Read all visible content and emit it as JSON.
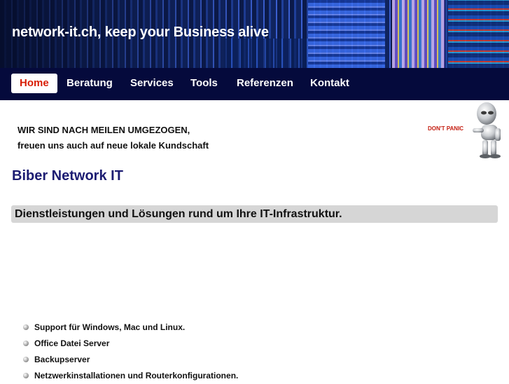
{
  "header": {
    "site_title": "network-it.ch, keep your Business alive"
  },
  "nav": {
    "items": [
      {
        "label": "Home",
        "active": true
      },
      {
        "label": "Beratung"
      },
      {
        "label": "Services"
      },
      {
        "label": "Tools"
      },
      {
        "label": "Referenzen"
      },
      {
        "label": "Kontakt"
      }
    ]
  },
  "notice": {
    "line1": "WIR SIND NACH MEILEN UMGEZOGEN,",
    "line2": "freuen uns auch auf neue lokale Kundschaft"
  },
  "robot_image": {
    "sign_text": "DON'T PANIC"
  },
  "main": {
    "title": "Biber Network IT",
    "tagline": "Dienstleistungen und Lösungen rund um Ihre IT-Infrastruktur.",
    "services": [
      "Support für Windows, Mac und Linux.",
      "Office Datei Server",
      "Backupserver",
      "Netzwerkinstallationen und Routerkonfigurationen."
    ]
  },
  "colors": {
    "nav_background": "#050a3c",
    "active_nav_text": "#d81e05",
    "title_color": "#1c1c72",
    "tagline_background": "#d6d6d6"
  }
}
